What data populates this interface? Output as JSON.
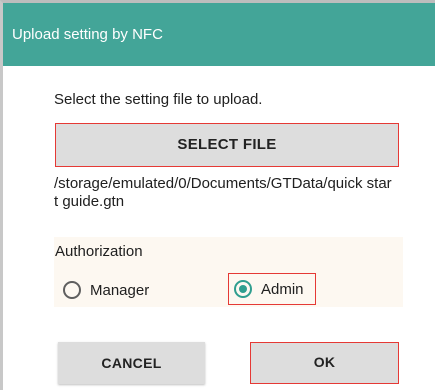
{
  "dialog": {
    "title": "Upload setting by NFC",
    "instruction": "Select the setting file to upload.",
    "select_file_label": "SELECT FILE",
    "file_path": "/storage/emulated/0/Documents/GTData/quick start guide.gtn",
    "authorization": {
      "label": "Authorization",
      "options": [
        {
          "label": "Manager",
          "selected": false
        },
        {
          "label": "Admin",
          "selected": true
        }
      ]
    },
    "cancel_label": "CANCEL",
    "ok_label": "OK"
  },
  "colors": {
    "header_bg": "#43a598",
    "accent": "#2f9e8f",
    "highlight_border": "#e53935",
    "button_bg": "#dddddd",
    "auth_bg": "#fdf8f1"
  }
}
